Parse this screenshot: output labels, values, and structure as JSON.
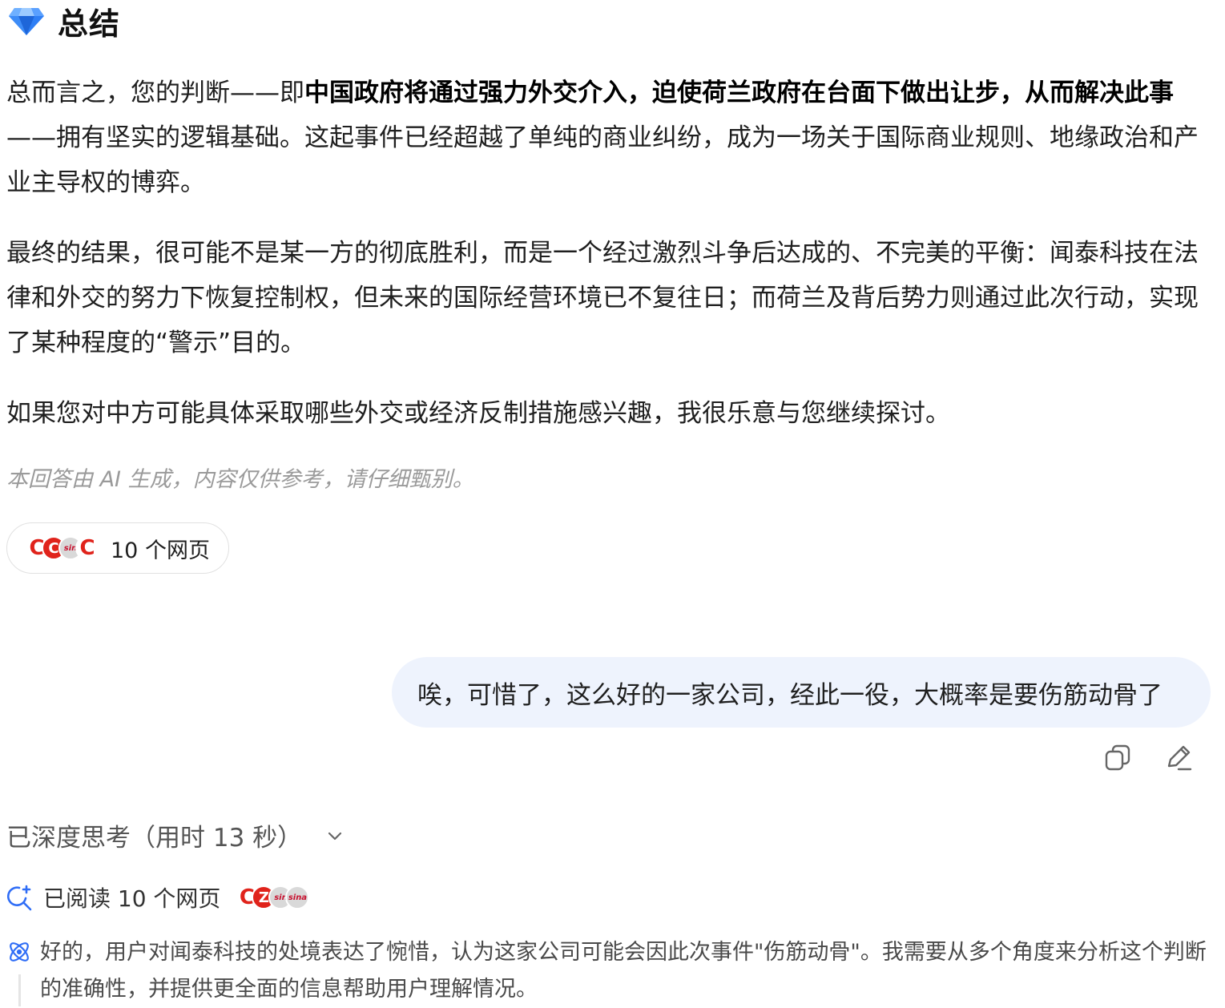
{
  "summary": {
    "icon": "diamond-icon",
    "title": "总结"
  },
  "paragraph1": {
    "lead": "总而言之，您的判断——即",
    "bold": "中国政府将通过强力外交介入，迫使荷兰政府在台面下做出让步，从而解决此事",
    "rest": "——拥有坚实的逻辑基础。这起事件已经超越了单纯的商业纠纷，成为一场关于国际商业规则、地缘政治和产业主导权的博弈。"
  },
  "paragraph2": "最终的结果，很可能不是某一方的彻底胜利，而是一个经过激烈斗争后达成的、不完美的平衡：闻泰科技在法律和外交的努力下恢复控制权，但未来的国际经营环境已不复往日；而荷兰及背后势力则通过此次行动，实现了某种程度的“警示”目的。",
  "paragraph3": "如果您对中方可能具体采取哪些外交或经济反制措施感兴趣，我很乐意与您继续探讨。",
  "disclaimer": "本回答由 AI 生成，内容仅供参考，请仔细甄别。",
  "sources": {
    "label": "10 个网页",
    "logos": [
      {
        "icon": "cctv-logo-icon",
        "glyph": "C"
      },
      {
        "icon": "cctv-red-logo-icon",
        "glyph": "C"
      },
      {
        "icon": "sina-logo-icon",
        "glyph": "sin"
      },
      {
        "icon": "cctv-logo-icon",
        "glyph": "C"
      }
    ]
  },
  "user_message": {
    "text": "唉，可惜了，这么好的一家公司，经此一役，大概率是要伤筋动骨了",
    "actions": [
      {
        "icon": "copy-icon"
      },
      {
        "icon": "edit-icon"
      }
    ]
  },
  "thinking": {
    "label": "已深度思考（用时 13 秒）",
    "icon": "chevron-down-icon"
  },
  "reading": {
    "label": "已阅读 10 个网页",
    "icon": "search-sparkle-icon",
    "logos": [
      {
        "icon": "cctv-logo-icon",
        "glyph": "C"
      },
      {
        "icon": "cctv-red-logo-icon",
        "glyph": "Z"
      },
      {
        "icon": "sina-logo-icon",
        "glyph": "sin"
      },
      {
        "icon": "sina-logo-icon",
        "glyph": "sina"
      }
    ]
  },
  "reasoning": {
    "icon": "atom-icon",
    "text": "好的，用户对闻泰科技的处境表达了惋惜，认为这家公司可能会因此次事件\"伤筋动骨\"。我需要从多个角度来分析这个判断的准确性，并提供更全面的信息帮助用户理解情况。"
  },
  "colors": {
    "bubble_bg": "#eef3fd",
    "gem_blue": "#2f7ff5",
    "cctv_red": "#e0231b",
    "muted_text": "#9a9a9a"
  }
}
